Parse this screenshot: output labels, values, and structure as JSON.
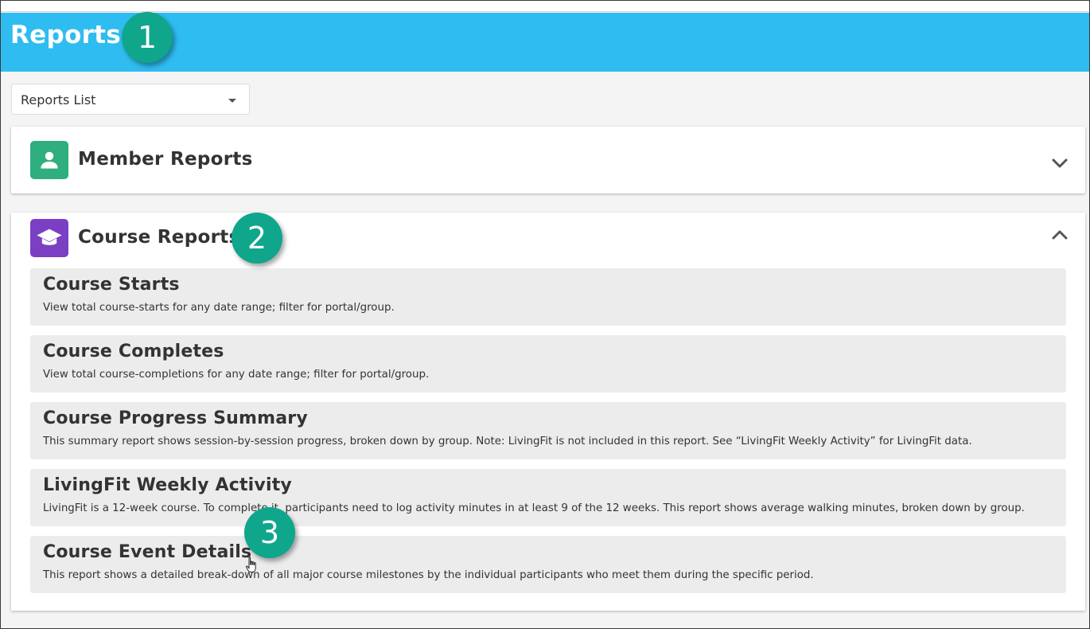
{
  "header": {
    "title": "Reports"
  },
  "callouts": {
    "one": "1",
    "two": "2",
    "three": "3"
  },
  "dropdown": {
    "selected": "Reports List"
  },
  "sections": {
    "member": {
      "title": "Member Reports",
      "icon": "person-icon",
      "icon_color": "#2eaf7d",
      "state": "collapsed"
    },
    "course": {
      "title": "Course Reports",
      "icon": "graduation-cap-icon",
      "icon_color": "#7b3fc4",
      "state": "expanded"
    }
  },
  "course_reports": [
    {
      "title": "Course Starts",
      "description": "View total course-starts for any date range; filter for portal/group."
    },
    {
      "title": "Course Completes",
      "description": "View total course-completions for any date range; filter for portal/group."
    },
    {
      "title": "Course Progress Summary",
      "description": "This summary report shows session-by-session progress, broken down by group. Note: LivingFit is not included in this report. See “LivingFit Weekly Activity” for LivingFit data."
    },
    {
      "title": "LivingFit Weekly Activity",
      "description": "LivingFit is a 12-week course. To complete it, participants need to log activity minutes in at least 9 of the 12 weeks. This report shows average walking minutes, broken down by group."
    },
    {
      "title": "Course Event Details",
      "description": "This report shows a detailed break-down of all major course milestones by the individual participants who meet them during the specific period."
    }
  ],
  "colors": {
    "header_bg": "#2fbcf0",
    "callout_bg": "#0fa68b",
    "item_bg": "#ececec"
  }
}
